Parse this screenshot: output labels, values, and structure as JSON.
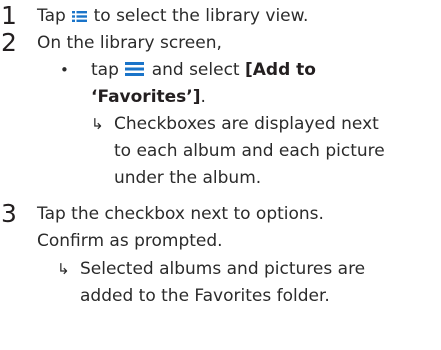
{
  "steps": [
    {
      "number": "1",
      "text_before_icon": "Tap",
      "icon": "library-grid-icon",
      "text_after_icon": "to select the library view."
    },
    {
      "number": "2",
      "text": "On the library screen,",
      "bullet": {
        "marker": "•",
        "text_before_icon": "tap",
        "icon": "menu-icon",
        "text_after_icon": "and select",
        "bold_line1": "[Add to",
        "bold_line2": "‘Favorites’]",
        "after_bold": ".",
        "result": {
          "marker": "↳",
          "lines": [
            "Checkboxes are displayed next",
            "to each album and each picture",
            "under the album."
          ]
        }
      }
    },
    {
      "number": "3",
      "lines": [
        "Tap the checkbox next to options.",
        "Confirm as prompted."
      ],
      "result": {
        "marker": "↳",
        "lines": [
          "Selected albums and pictures are",
          "added to the Favorites folder."
        ]
      }
    }
  ],
  "colors": {
    "text": "#2b2b2b",
    "icon_blue": "#1a74c9"
  }
}
